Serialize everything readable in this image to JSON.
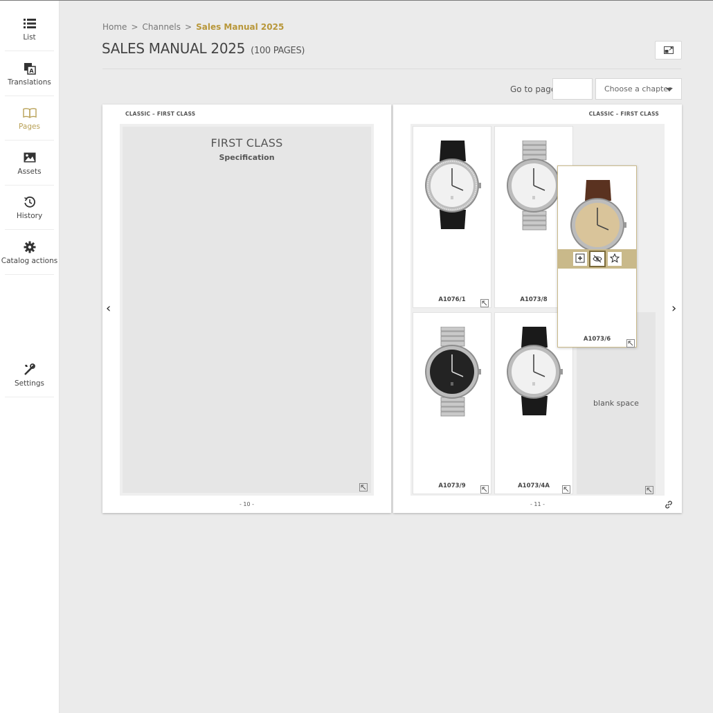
{
  "sidebar": {
    "items": [
      {
        "label": "List",
        "icon": "list-icon"
      },
      {
        "label": "Translations",
        "icon": "translate-icon"
      },
      {
        "label": "Pages",
        "icon": "book-icon",
        "active": true
      },
      {
        "label": "Assets",
        "icon": "image-icon"
      },
      {
        "label": "History",
        "icon": "history-icon"
      },
      {
        "label": "Catalog actions",
        "icon": "gear-icon"
      },
      {
        "label": "Settings",
        "icon": "tools-icon"
      }
    ]
  },
  "breadcrumb": {
    "home": "Home",
    "channels": "Channels",
    "separator": ">",
    "current": "Sales Manual 2025"
  },
  "header": {
    "title": "SALES MANUAL 2025",
    "subtitle": "(100 PAGES)"
  },
  "navigation": {
    "goto_label": "Go to page:",
    "goto_value": "",
    "chapter_placeholder": "Choose a chapter"
  },
  "spread": {
    "left": {
      "header": "CLASSIC – FIRST CLASS",
      "title": "FIRST CLASS",
      "subtitle": "Specification",
      "page_number": "- 10 -"
    },
    "right": {
      "header": "CLASSIC – FIRST CLASS",
      "page_number": "- 11 -",
      "products": [
        {
          "code": "A1076/1"
        },
        {
          "code": "A1073/8"
        },
        {
          "code": "A1073/6"
        },
        {
          "code": "A1073/9"
        },
        {
          "code": "A1073/4A"
        }
      ],
      "blank_label": "blank space"
    }
  },
  "arrows": {
    "prev": "‹",
    "next": "›"
  },
  "colors": {
    "accent": "#b8a055",
    "action_bar": "#c9b98a",
    "background": "#ebebeb"
  }
}
